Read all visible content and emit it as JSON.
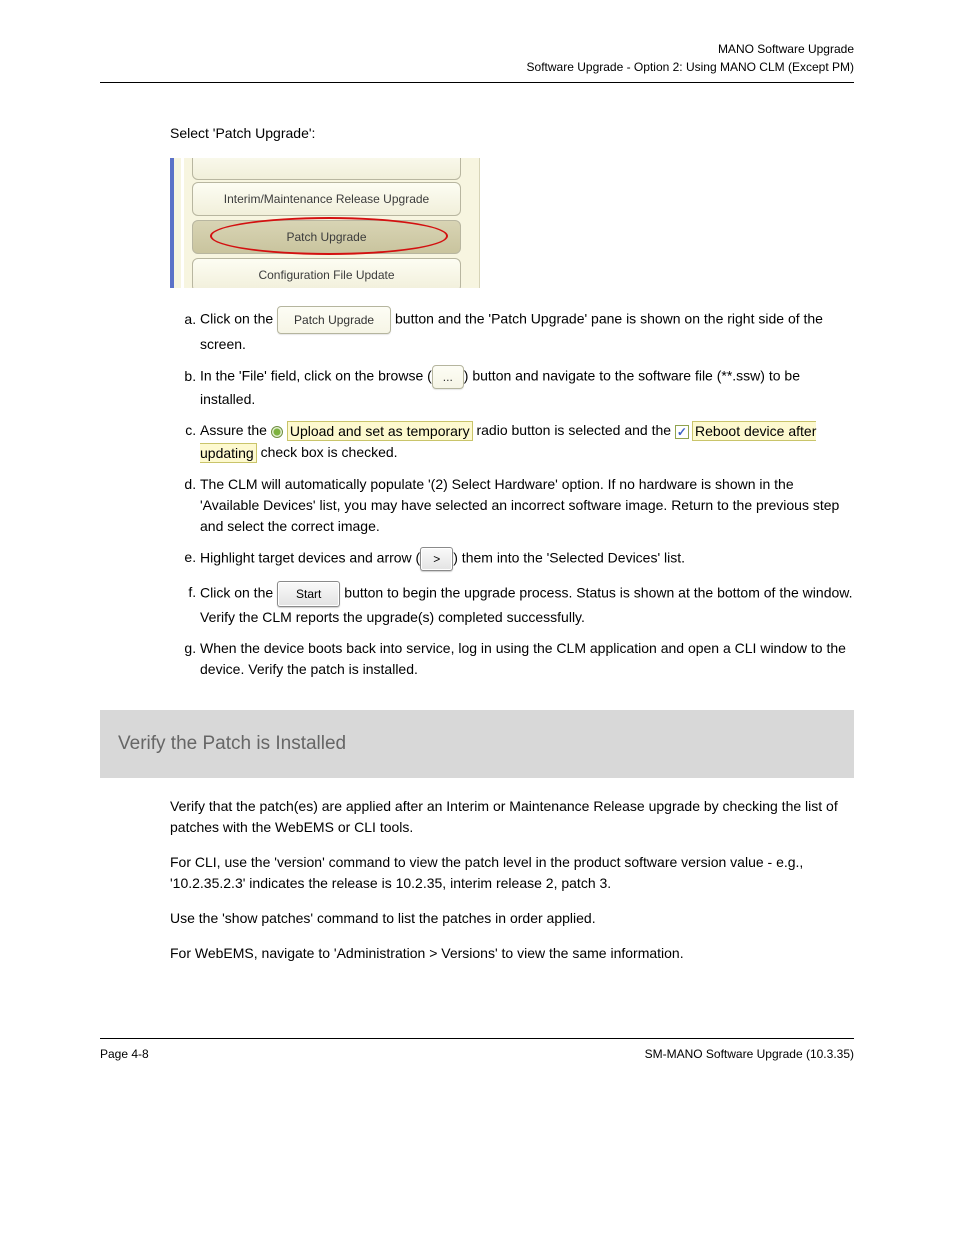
{
  "header": {
    "left": "",
    "right_top": "MANO Software Upgrade",
    "right_sub": "Software Upgrade - Option 2: Using MANO CLM (Except PM)"
  },
  "pre_shot": "Select 'Patch Upgrade':",
  "shot": {
    "btn1": "Interim/Maintenance Release Upgrade",
    "btn2": "Patch Upgrade",
    "btn3": "Configuration File Update"
  },
  "btn_patch": "Patch Upgrade",
  "btn_browse": "...",
  "radio_upload": "Upload and set as temporary",
  "chk_reboot": "Reboot device after updating",
  "btn_arrow": ">",
  "btn_start": "Start",
  "list": {
    "a": {
      "pre": "Click on the ",
      "mid": " button and the 'Patch Upgrade' pane is shown on the right side of the screen."
    },
    "b": {
      "p1": "In the 'File' field, click on the browse (",
      "p2": ") button and navigate to the software file (**.ssw) to be installed."
    },
    "c": {
      "p1": "Assure the ",
      "p2": " radio button is selected and the ",
      "p3": " check box is checked."
    },
    "d": "The CLM will automatically populate '(2) Select Hardware' option. If no hardware is shown in the 'Available Devices' list, you may have selected an incorrect software image. Return to the previous step and select the correct image.",
    "e": {
      "p1": "Highlight target devices and arrow (",
      "p2": ") them into the 'Selected Devices' list."
    },
    "f": {
      "p1": "Click on the ",
      "p2": " button to begin the upgrade process. Status is shown at the bottom of the window. Verify the CLM reports the upgrade(s) completed successfully."
    },
    "g": "When the device boots back into service, log in using the CLM application and open a CLI window to the device. Verify the patch is installed."
  },
  "section": {
    "title": "Verify the Patch is Installed",
    "p1": "Verify that the patch(es) are applied after an Interim or Maintenance Release upgrade by checking the list of patches with the WebEMS or CLI tools.",
    "p2": "For CLI, use the 'version' command to view the patch level in the product software version value - e.g., '10.2.35.2.3' indicates the release is 10.2.35, interim release 2, patch 3.",
    "p3": "Use the 'show patches' command to list the patches in order applied.",
    "p4": "For WebEMS, navigate to 'Administration > Versions' to view the same information."
  },
  "footer": {
    "left": "Page 4-8",
    "right": "SM-MANO Software Upgrade (10.3.35)"
  }
}
